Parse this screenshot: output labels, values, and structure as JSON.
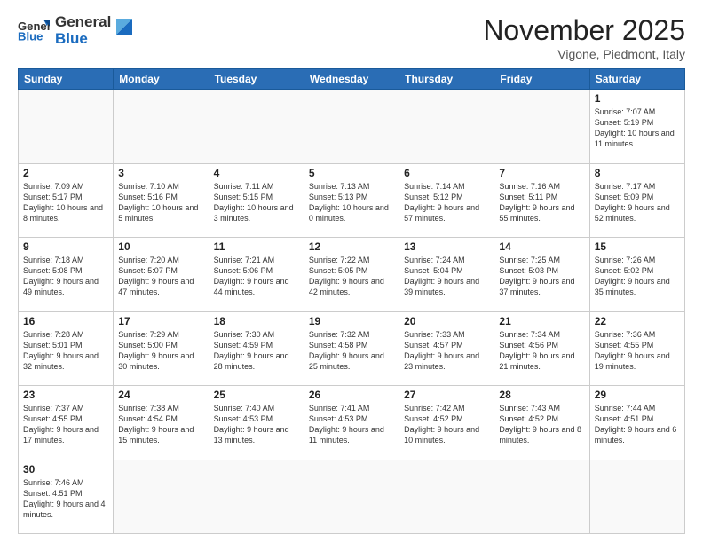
{
  "header": {
    "logo_general": "General",
    "logo_blue": "Blue",
    "month_title": "November 2025",
    "location": "Vigone, Piedmont, Italy"
  },
  "weekdays": [
    "Sunday",
    "Monday",
    "Tuesday",
    "Wednesday",
    "Thursday",
    "Friday",
    "Saturday"
  ],
  "weeks": [
    [
      {
        "day": "",
        "info": ""
      },
      {
        "day": "",
        "info": ""
      },
      {
        "day": "",
        "info": ""
      },
      {
        "day": "",
        "info": ""
      },
      {
        "day": "",
        "info": ""
      },
      {
        "day": "",
        "info": ""
      },
      {
        "day": "1",
        "info": "Sunrise: 7:07 AM\nSunset: 5:19 PM\nDaylight: 10 hours and 11 minutes."
      }
    ],
    [
      {
        "day": "2",
        "info": "Sunrise: 7:09 AM\nSunset: 5:17 PM\nDaylight: 10 hours and 8 minutes."
      },
      {
        "day": "3",
        "info": "Sunrise: 7:10 AM\nSunset: 5:16 PM\nDaylight: 10 hours and 5 minutes."
      },
      {
        "day": "4",
        "info": "Sunrise: 7:11 AM\nSunset: 5:15 PM\nDaylight: 10 hours and 3 minutes."
      },
      {
        "day": "5",
        "info": "Sunrise: 7:13 AM\nSunset: 5:13 PM\nDaylight: 10 hours and 0 minutes."
      },
      {
        "day": "6",
        "info": "Sunrise: 7:14 AM\nSunset: 5:12 PM\nDaylight: 9 hours and 57 minutes."
      },
      {
        "day": "7",
        "info": "Sunrise: 7:16 AM\nSunset: 5:11 PM\nDaylight: 9 hours and 55 minutes."
      },
      {
        "day": "8",
        "info": "Sunrise: 7:17 AM\nSunset: 5:09 PM\nDaylight: 9 hours and 52 minutes."
      }
    ],
    [
      {
        "day": "9",
        "info": "Sunrise: 7:18 AM\nSunset: 5:08 PM\nDaylight: 9 hours and 49 minutes."
      },
      {
        "day": "10",
        "info": "Sunrise: 7:20 AM\nSunset: 5:07 PM\nDaylight: 9 hours and 47 minutes."
      },
      {
        "day": "11",
        "info": "Sunrise: 7:21 AM\nSunset: 5:06 PM\nDaylight: 9 hours and 44 minutes."
      },
      {
        "day": "12",
        "info": "Sunrise: 7:22 AM\nSunset: 5:05 PM\nDaylight: 9 hours and 42 minutes."
      },
      {
        "day": "13",
        "info": "Sunrise: 7:24 AM\nSunset: 5:04 PM\nDaylight: 9 hours and 39 minutes."
      },
      {
        "day": "14",
        "info": "Sunrise: 7:25 AM\nSunset: 5:03 PM\nDaylight: 9 hours and 37 minutes."
      },
      {
        "day": "15",
        "info": "Sunrise: 7:26 AM\nSunset: 5:02 PM\nDaylight: 9 hours and 35 minutes."
      }
    ],
    [
      {
        "day": "16",
        "info": "Sunrise: 7:28 AM\nSunset: 5:01 PM\nDaylight: 9 hours and 32 minutes."
      },
      {
        "day": "17",
        "info": "Sunrise: 7:29 AM\nSunset: 5:00 PM\nDaylight: 9 hours and 30 minutes."
      },
      {
        "day": "18",
        "info": "Sunrise: 7:30 AM\nSunset: 4:59 PM\nDaylight: 9 hours and 28 minutes."
      },
      {
        "day": "19",
        "info": "Sunrise: 7:32 AM\nSunset: 4:58 PM\nDaylight: 9 hours and 25 minutes."
      },
      {
        "day": "20",
        "info": "Sunrise: 7:33 AM\nSunset: 4:57 PM\nDaylight: 9 hours and 23 minutes."
      },
      {
        "day": "21",
        "info": "Sunrise: 7:34 AM\nSunset: 4:56 PM\nDaylight: 9 hours and 21 minutes."
      },
      {
        "day": "22",
        "info": "Sunrise: 7:36 AM\nSunset: 4:55 PM\nDaylight: 9 hours and 19 minutes."
      }
    ],
    [
      {
        "day": "23",
        "info": "Sunrise: 7:37 AM\nSunset: 4:55 PM\nDaylight: 9 hours and 17 minutes."
      },
      {
        "day": "24",
        "info": "Sunrise: 7:38 AM\nSunset: 4:54 PM\nDaylight: 9 hours and 15 minutes."
      },
      {
        "day": "25",
        "info": "Sunrise: 7:40 AM\nSunset: 4:53 PM\nDaylight: 9 hours and 13 minutes."
      },
      {
        "day": "26",
        "info": "Sunrise: 7:41 AM\nSunset: 4:53 PM\nDaylight: 9 hours and 11 minutes."
      },
      {
        "day": "27",
        "info": "Sunrise: 7:42 AM\nSunset: 4:52 PM\nDaylight: 9 hours and 10 minutes."
      },
      {
        "day": "28",
        "info": "Sunrise: 7:43 AM\nSunset: 4:52 PM\nDaylight: 9 hours and 8 minutes."
      },
      {
        "day": "29",
        "info": "Sunrise: 7:44 AM\nSunset: 4:51 PM\nDaylight: 9 hours and 6 minutes."
      }
    ],
    [
      {
        "day": "30",
        "info": "Sunrise: 7:46 AM\nSunset: 4:51 PM\nDaylight: 9 hours and 4 minutes."
      },
      {
        "day": "",
        "info": ""
      },
      {
        "day": "",
        "info": ""
      },
      {
        "day": "",
        "info": ""
      },
      {
        "day": "",
        "info": ""
      },
      {
        "day": "",
        "info": ""
      },
      {
        "day": "",
        "info": ""
      }
    ]
  ]
}
